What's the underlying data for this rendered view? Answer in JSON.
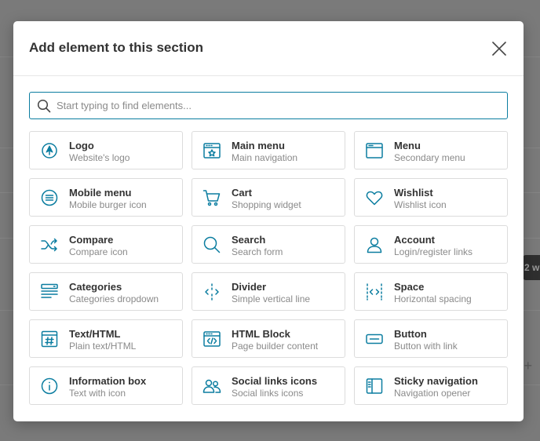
{
  "modal": {
    "title": "Add element to this section",
    "search_placeholder": "Start typing to find elements..."
  },
  "background": {
    "chip_text": "2 w"
  },
  "colors": {
    "accent": "#0b7da0",
    "icon": "#0b7da0",
    "overlay": "#7b7b7b"
  },
  "elements": [
    {
      "title": "Logo",
      "subtitle": "Website's logo",
      "icon": "logo-icon"
    },
    {
      "title": "Main menu",
      "subtitle": "Main navigation",
      "icon": "main-menu-icon"
    },
    {
      "title": "Menu",
      "subtitle": "Secondary menu",
      "icon": "menu-icon"
    },
    {
      "title": "Mobile menu",
      "subtitle": "Mobile burger icon",
      "icon": "mobile-menu-icon"
    },
    {
      "title": "Cart",
      "subtitle": "Shopping widget",
      "icon": "cart-icon"
    },
    {
      "title": "Wishlist",
      "subtitle": "Wishlist icon",
      "icon": "heart-icon"
    },
    {
      "title": "Compare",
      "subtitle": "Compare icon",
      "icon": "compare-icon"
    },
    {
      "title": "Search",
      "subtitle": "Search form",
      "icon": "search-icon"
    },
    {
      "title": "Account",
      "subtitle": "Login/register links",
      "icon": "user-icon"
    },
    {
      "title": "Categories",
      "subtitle": "Categories dropdown",
      "icon": "categories-icon"
    },
    {
      "title": "Divider",
      "subtitle": "Simple vertical line",
      "icon": "divider-icon"
    },
    {
      "title": "Space",
      "subtitle": "Horizontal spacing",
      "icon": "space-icon"
    },
    {
      "title": "Text/HTML",
      "subtitle": "Plain text/HTML",
      "icon": "text-html-icon"
    },
    {
      "title": "HTML Block",
      "subtitle": "Page builder content",
      "icon": "html-block-icon"
    },
    {
      "title": "Button",
      "subtitle": "Button with link",
      "icon": "button-icon"
    },
    {
      "title": "Information box",
      "subtitle": "Text with icon",
      "icon": "info-icon"
    },
    {
      "title": "Social links icons",
      "subtitle": "Social links icons",
      "icon": "social-icon"
    },
    {
      "title": "Sticky navigation",
      "subtitle": "Navigation opener",
      "icon": "sticky-navigation-icon"
    }
  ]
}
